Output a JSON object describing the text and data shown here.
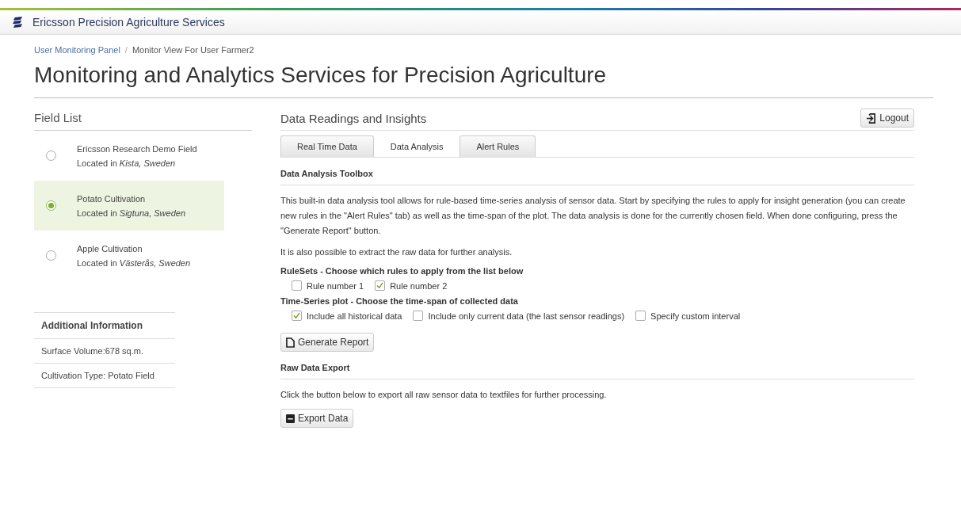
{
  "navbar": {
    "brand": "Ericsson Precision Agriculture Services"
  },
  "breadcrumb_separator": "/",
  "breadcrumb": [
    {
      "label": "User Monitoring Panel",
      "kind": "link"
    },
    {
      "label": "Monitor View For User Farmer2",
      "kind": "current"
    }
  ],
  "page_title": "Monitoring and Analytics Services for Precision Agriculture",
  "field_list": {
    "title": "Field List",
    "items": [
      {
        "name": "Ericsson Research Demo Field",
        "location": "Located in *Kista, Sweden*",
        "selected": false
      },
      {
        "name": "Potato Cultivation",
        "location": "Located in *Sigtuna, Sweden*",
        "selected": true
      },
      {
        "name": "Apple Cultivation",
        "location": "Located in *Västerås, Sweden*",
        "selected": false
      }
    ]
  },
  "additional_info": {
    "title": "Additional Information",
    "rows": [
      "Surface Volume:678 sq.m.",
      "Cultivation Type: Potato Field"
    ]
  },
  "panel": {
    "title": "Data Readings and Insights",
    "logout": "Logout",
    "tabs": [
      {
        "label": "Real Time Data",
        "selected": false
      },
      {
        "label": "Data Analysis",
        "selected": true
      },
      {
        "label": "Alert Rules",
        "selected": false
      }
    ],
    "toolbox_title": "Data Analysis Toolbox",
    "description": "This built-in data analysis tool allows for rule-based time-series analysis of sensor data. Start by specifying the rules to apply for insight generation (you can create new rules in the \"Alert Rules\" tab) as well as the time-span of the plot. The data analysis is done for the currently chosen field. When done configuring, press the \"Generate Report\" button.",
    "extract_note": "It is also possible to extract the raw data for further analysis.",
    "rulesets_label": "RuleSets - Choose which rules to apply from the list below",
    "rules": [
      {
        "label": "Rule number 1",
        "checked": false
      },
      {
        "label": "Rule number 2",
        "checked": true
      }
    ],
    "timespan_label": "Time-Series plot - Choose the time-span of collected data",
    "timespans": [
      {
        "label": "Include all historical data",
        "checked": true
      },
      {
        "label": "Include only current data (the last sensor readings)",
        "checked": false
      },
      {
        "label": "Specify custom interval",
        "checked": false
      }
    ],
    "generate_button": "Generate Report",
    "export_title": "Raw Data Export",
    "export_note": "Click the button below to export all raw sensor data to textfiles for further processing.",
    "export_button": "Export Data"
  }
}
